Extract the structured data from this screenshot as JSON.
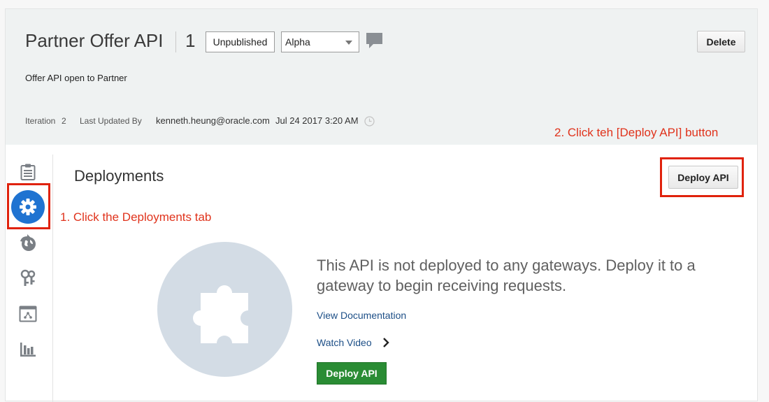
{
  "header": {
    "title": "Partner Offer API",
    "version": "1",
    "status_label": "Unpublished",
    "stage_select": {
      "value": "Alpha"
    },
    "delete_label": "Delete",
    "description": "Offer API open to Partner",
    "iteration_label": "Iteration",
    "iteration_value": "2",
    "last_updated_label": "Last Updated By",
    "last_updated_user": "kenneth.heung@oracle.com",
    "last_updated_time": "Jul 24 2017 3:20 AM"
  },
  "annotations": {
    "step1": "1. Click the Deployments tab",
    "step2": "2. Click teh [Deploy API] button"
  },
  "sidebar": {
    "items": [
      {
        "icon": "clipboard-icon",
        "active": false
      },
      {
        "icon": "gear-icon",
        "active": true
      },
      {
        "icon": "globe-arrow-icon",
        "active": false
      },
      {
        "icon": "keys-icon",
        "active": false
      },
      {
        "icon": "window-network-icon",
        "active": false
      },
      {
        "icon": "bar-chart-icon",
        "active": false
      }
    ]
  },
  "main": {
    "section_title": "Deployments",
    "deploy_button_label": "Deploy API",
    "empty_message": "This API is not deployed to any gateways. Deploy it to a gateway to begin receiving requests.",
    "view_docs_label": "View Documentation",
    "watch_video_label": "Watch Video",
    "deploy_primary_label": "Deploy API",
    "empty_icon": "puzzle-piece-icon"
  },
  "colors": {
    "accent_blue": "#1f73d1",
    "annotation_red": "#e0331c",
    "primary_green": "#2a8c34",
    "link_blue": "#1d4f87"
  }
}
